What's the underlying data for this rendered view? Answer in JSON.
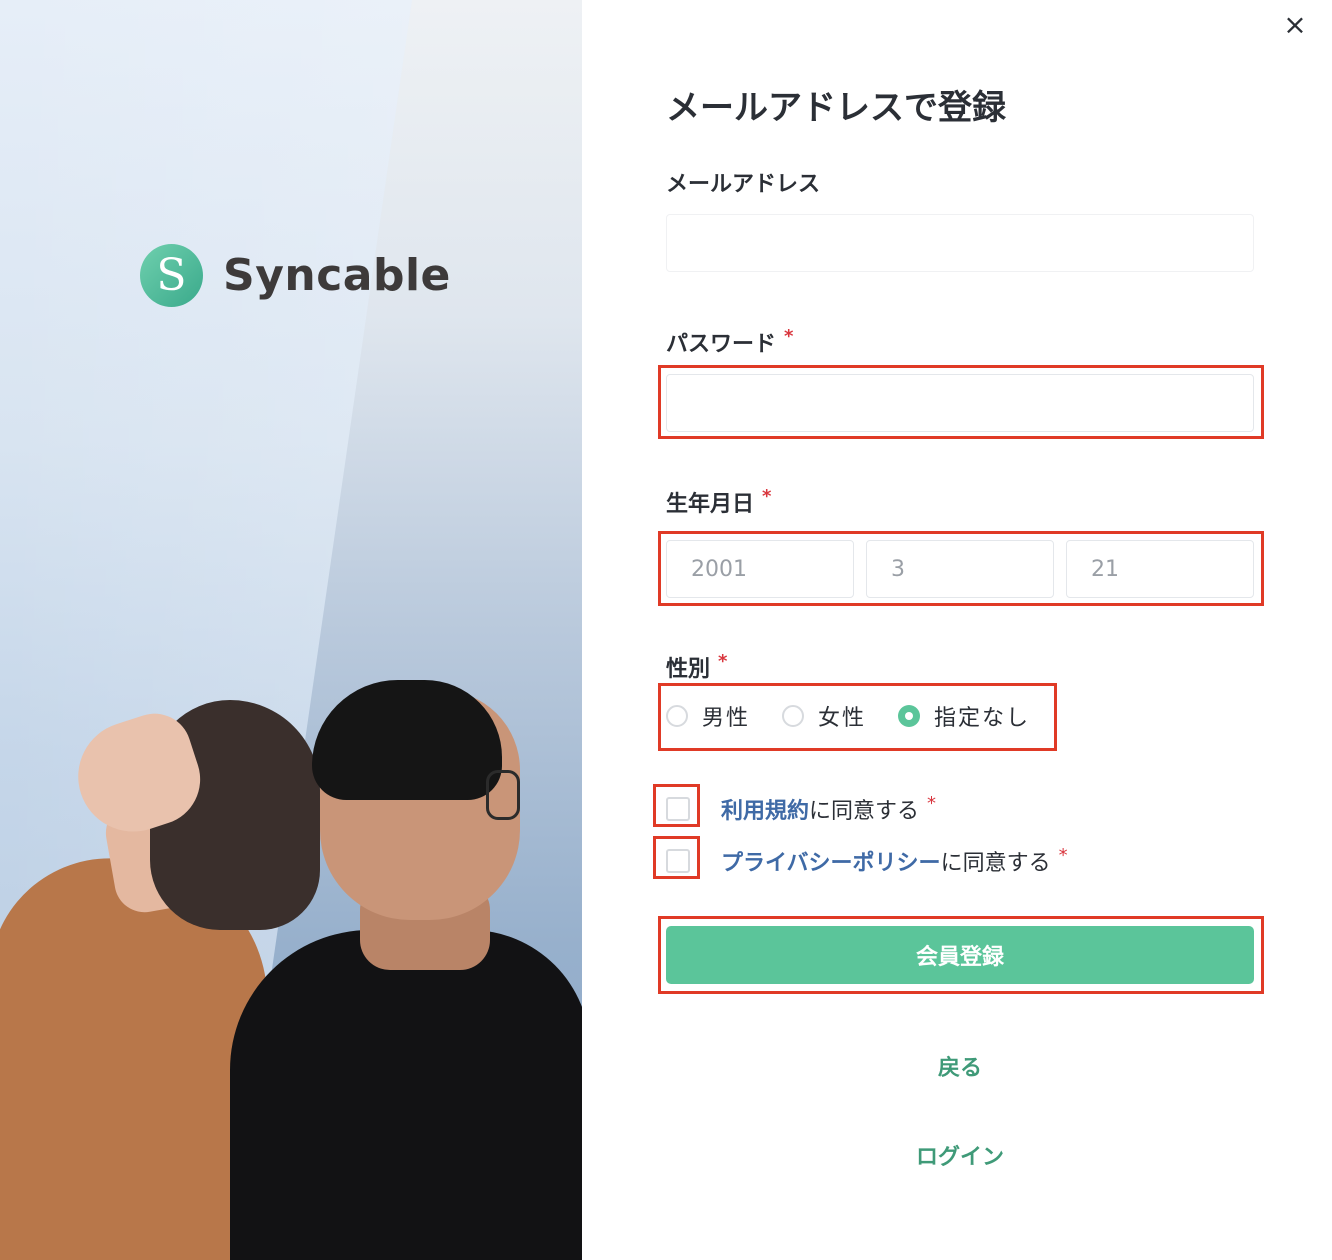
{
  "brand": {
    "name": "Syncable",
    "mark": "S",
    "color": "#5bc59a"
  },
  "form": {
    "title": "メールアドレスで登録",
    "close_icon": "×",
    "email": {
      "label": "メールアドレス",
      "value": ""
    },
    "password": {
      "label": "パスワード",
      "required_mark": "*",
      "value": ""
    },
    "birthday": {
      "label": "生年月日",
      "required_mark": "*",
      "year": "2001",
      "month": "3",
      "day": "21"
    },
    "gender": {
      "label": "性別",
      "required_mark": "*",
      "options": [
        {
          "label": "男性",
          "selected": false
        },
        {
          "label": "女性",
          "selected": false
        },
        {
          "label": "指定なし",
          "selected": true
        }
      ]
    },
    "terms": {
      "link": "利用規約",
      "suffix": "に同意する",
      "required_mark": "*",
      "checked": false
    },
    "privacy": {
      "link": "プライバシーポリシー",
      "suffix": "に同意する",
      "required_mark": "*",
      "checked": false
    },
    "submit_label": "会員登録",
    "back_label": "戻る",
    "login_label": "ログイン"
  },
  "colors": {
    "accent": "#5bc59a",
    "link": "#3f6aa6",
    "required": "#d9363e",
    "highlight": "#e03a26"
  }
}
